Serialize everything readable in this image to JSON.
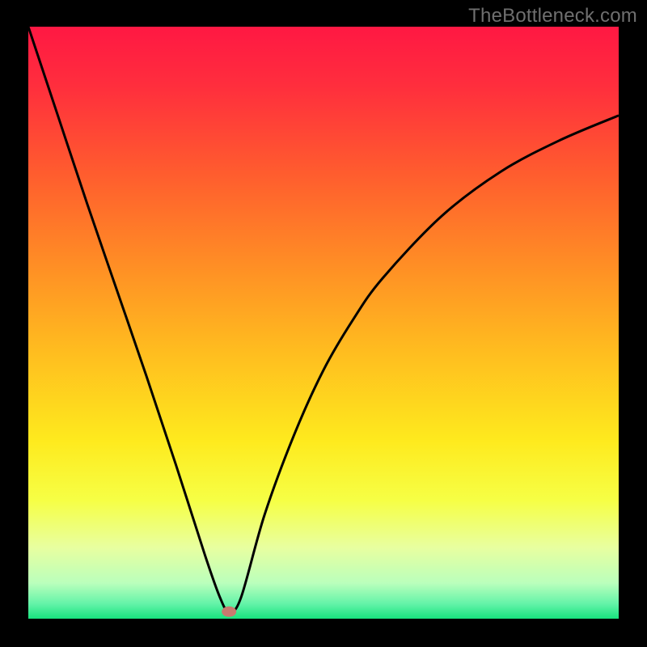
{
  "watermark": "TheBottleneck.com",
  "chart_data": {
    "type": "line",
    "title": "",
    "xlabel": "",
    "ylabel": "",
    "xlim": [
      0,
      1
    ],
    "ylim": [
      0,
      1
    ],
    "series": [
      {
        "name": "bottleneck-curve",
        "x": [
          0.0,
          0.05,
          0.1,
          0.15,
          0.2,
          0.25,
          0.3,
          0.325,
          0.34,
          0.36,
          0.4,
          0.45,
          0.5,
          0.55,
          0.6,
          0.7,
          0.8,
          0.9,
          1.0
        ],
        "y": [
          1.0,
          0.85,
          0.7,
          0.555,
          0.41,
          0.26,
          0.105,
          0.035,
          0.012,
          0.035,
          0.175,
          0.31,
          0.42,
          0.505,
          0.575,
          0.68,
          0.755,
          0.808,
          0.85
        ]
      }
    ],
    "marker": {
      "x": 0.34,
      "y": 0.012,
      "color": "#c97a6f"
    },
    "gradient_stops": [
      {
        "offset": 0.0,
        "color": "#ff1843"
      },
      {
        "offset": 0.1,
        "color": "#ff2e3d"
      },
      {
        "offset": 0.25,
        "color": "#ff5d2e"
      },
      {
        "offset": 0.4,
        "color": "#ff8d25"
      },
      {
        "offset": 0.55,
        "color": "#ffbd1f"
      },
      {
        "offset": 0.7,
        "color": "#feea1e"
      },
      {
        "offset": 0.8,
        "color": "#f6ff45"
      },
      {
        "offset": 0.88,
        "color": "#e8ffa0"
      },
      {
        "offset": 0.94,
        "color": "#baffbc"
      },
      {
        "offset": 0.975,
        "color": "#63f3a8"
      },
      {
        "offset": 1.0,
        "color": "#18e47e"
      }
    ]
  }
}
